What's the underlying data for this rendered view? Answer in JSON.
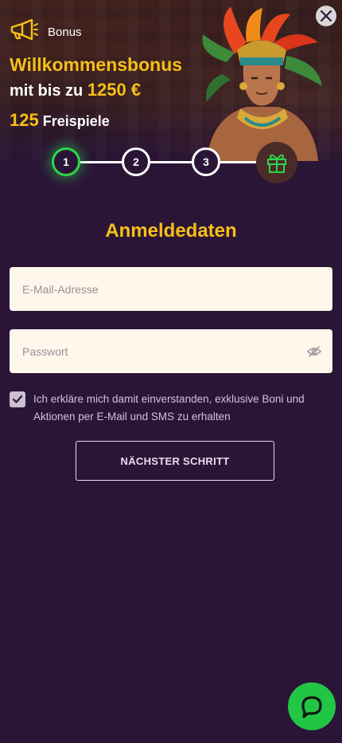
{
  "header": {
    "bonus_label": "Bonus",
    "headline_line1": "Willkommensbonus",
    "headline_prefix": "mit bis zu",
    "headline_amount": "1250 €",
    "spins_count": "125",
    "spins_label": "Freispiele"
  },
  "icons": {
    "megaphone": "megaphone-icon",
    "close": "close-icon",
    "gift": "gift-icon",
    "eye_off": "eye-off-icon",
    "check": "check-icon",
    "chat": "chat-icon"
  },
  "steps": {
    "labels": [
      "1",
      "2",
      "3"
    ],
    "active_index": 0
  },
  "form": {
    "title": "Anmeldedaten",
    "email_placeholder": "E-Mail-Adresse",
    "password_placeholder": "Passwort",
    "consent_text": "Ich erkläre mich damit einverstanden, exklusive Boni und Aktionen per E-Mail und SMS zu erhalten",
    "consent_checked": true,
    "next_button": "NÄCHSTER SCHRITT"
  },
  "colors": {
    "background": "#2b1537",
    "accent_yellow": "#f6bf16",
    "active_step_green": "#2bd64a",
    "chat_green": "#22c645",
    "input_bg": "#fdf7ec"
  }
}
